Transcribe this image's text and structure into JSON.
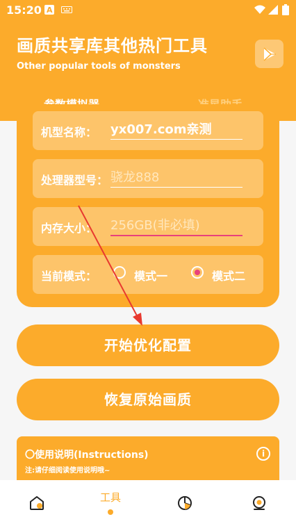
{
  "status_bar": {
    "time": "15:20"
  },
  "header": {
    "title": "画质共享库其他热门工具",
    "subtitle": "Other popular tools of monsters"
  },
  "tabs": [
    {
      "label": "参数模拟器",
      "active": true
    },
    {
      "label": "准星助手",
      "active": false
    }
  ],
  "form": {
    "model": {
      "label": "机型名称：",
      "value": "yx007.com亲测"
    },
    "processor": {
      "label": "处理器型号：",
      "placeholder": "骁龙888"
    },
    "memory": {
      "label": "内存大小：",
      "placeholder": "256GB(非必填)"
    },
    "mode": {
      "label": "当前模式：",
      "options": [
        {
          "label": "模式一",
          "selected": false
        },
        {
          "label": "模式二",
          "selected": true
        }
      ]
    }
  },
  "buttons": {
    "optimize": "开始优化配置",
    "restore": "恢复原始画质"
  },
  "instructions": {
    "title": "〇使用说明(Instructions)",
    "subtitle": "注:请仔细阅读使用说明哦~"
  },
  "bottom_nav": {
    "items": [
      {
        "icon": "home-icon",
        "label": ""
      },
      {
        "icon": "tools-icon",
        "label": "工具",
        "active": true
      },
      {
        "icon": "pie-chart-icon",
        "label": ""
      },
      {
        "icon": "profile-icon",
        "label": ""
      }
    ]
  },
  "colors": {
    "accent": "#fcab2b",
    "field_bg": "#fdc46a",
    "focus": "#e8417c"
  }
}
